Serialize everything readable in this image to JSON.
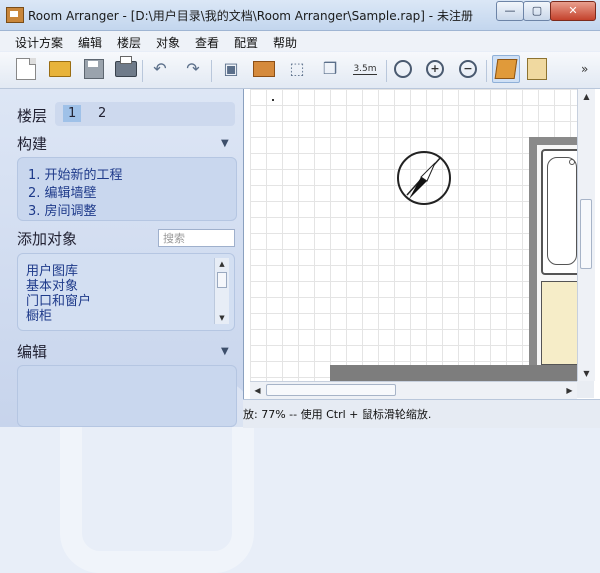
{
  "window": {
    "title": "Room Arranger - [D:\\用户目录\\我的文档\\Room Arranger\\Sample.rap] - 未注册",
    "min_label": "—",
    "max_label": "▢",
    "close_label": "✕"
  },
  "menu": [
    "设计方案",
    "编辑",
    "楼层",
    "对象",
    "查看",
    "配置",
    "帮助"
  ],
  "toolbar": {
    "dimension_label": "3.5m",
    "overflow_label": "»"
  },
  "left_panel": {
    "floor_label": "楼层",
    "floors": [
      "1",
      "2"
    ],
    "build_title": "构建",
    "steps": [
      "1.  开始新的工程",
      "2.  编辑墙壁",
      "3.  房间调整"
    ],
    "add_object_title": "添加对象",
    "search_placeholder": "搜索",
    "library_items": [
      "用户图库",
      "基本对象",
      "门口和窗户",
      "橱柜"
    ],
    "edit_title": "编辑",
    "collapse_arrow": "▼"
  },
  "status": {
    "text": "放: 77% -- 使用 Ctrl + 鼠标滑轮缩放."
  },
  "colors": {
    "accent": "#9fc1e8",
    "panel": "#c9d7ee",
    "cabinet": "#f6edc8"
  }
}
